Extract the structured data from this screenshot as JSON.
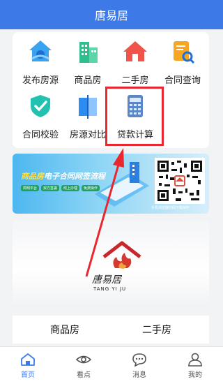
{
  "header": {
    "title": "唐易居"
  },
  "grid": {
    "items": [
      {
        "label": "发布房源",
        "icon": "publish-house-icon"
      },
      {
        "label": "商品房",
        "icon": "commercial-building-icon"
      },
      {
        "label": "二手房",
        "icon": "second-hand-house-icon"
      },
      {
        "label": "合同查询",
        "icon": "contract-search-icon"
      },
      {
        "label": "合同校验",
        "icon": "contract-verify-icon"
      },
      {
        "label": "房源对比",
        "icon": "house-compare-icon"
      },
      {
        "label": "贷款计算",
        "icon": "loan-calculator-icon"
      }
    ]
  },
  "banner1": {
    "title_part1": "商品房",
    "title_part2": "电子合同网签流程",
    "tags": [
      "简明平台",
      "双方签署",
      "线上办理",
      "免费操作"
    ],
    "qr_caption": "手机浏览器扫码下载APP"
  },
  "banner2": {
    "logo_cn": "唐易居",
    "logo_en": "TANG YI JU"
  },
  "tabs": {
    "commercial": "商品房",
    "second_hand": "二手房"
  },
  "nav": {
    "home": "首页",
    "view": "看点",
    "messages": "消息",
    "mine": "我的"
  },
  "colors": {
    "primary": "#3d7ae8",
    "highlight": "#e8282e"
  }
}
